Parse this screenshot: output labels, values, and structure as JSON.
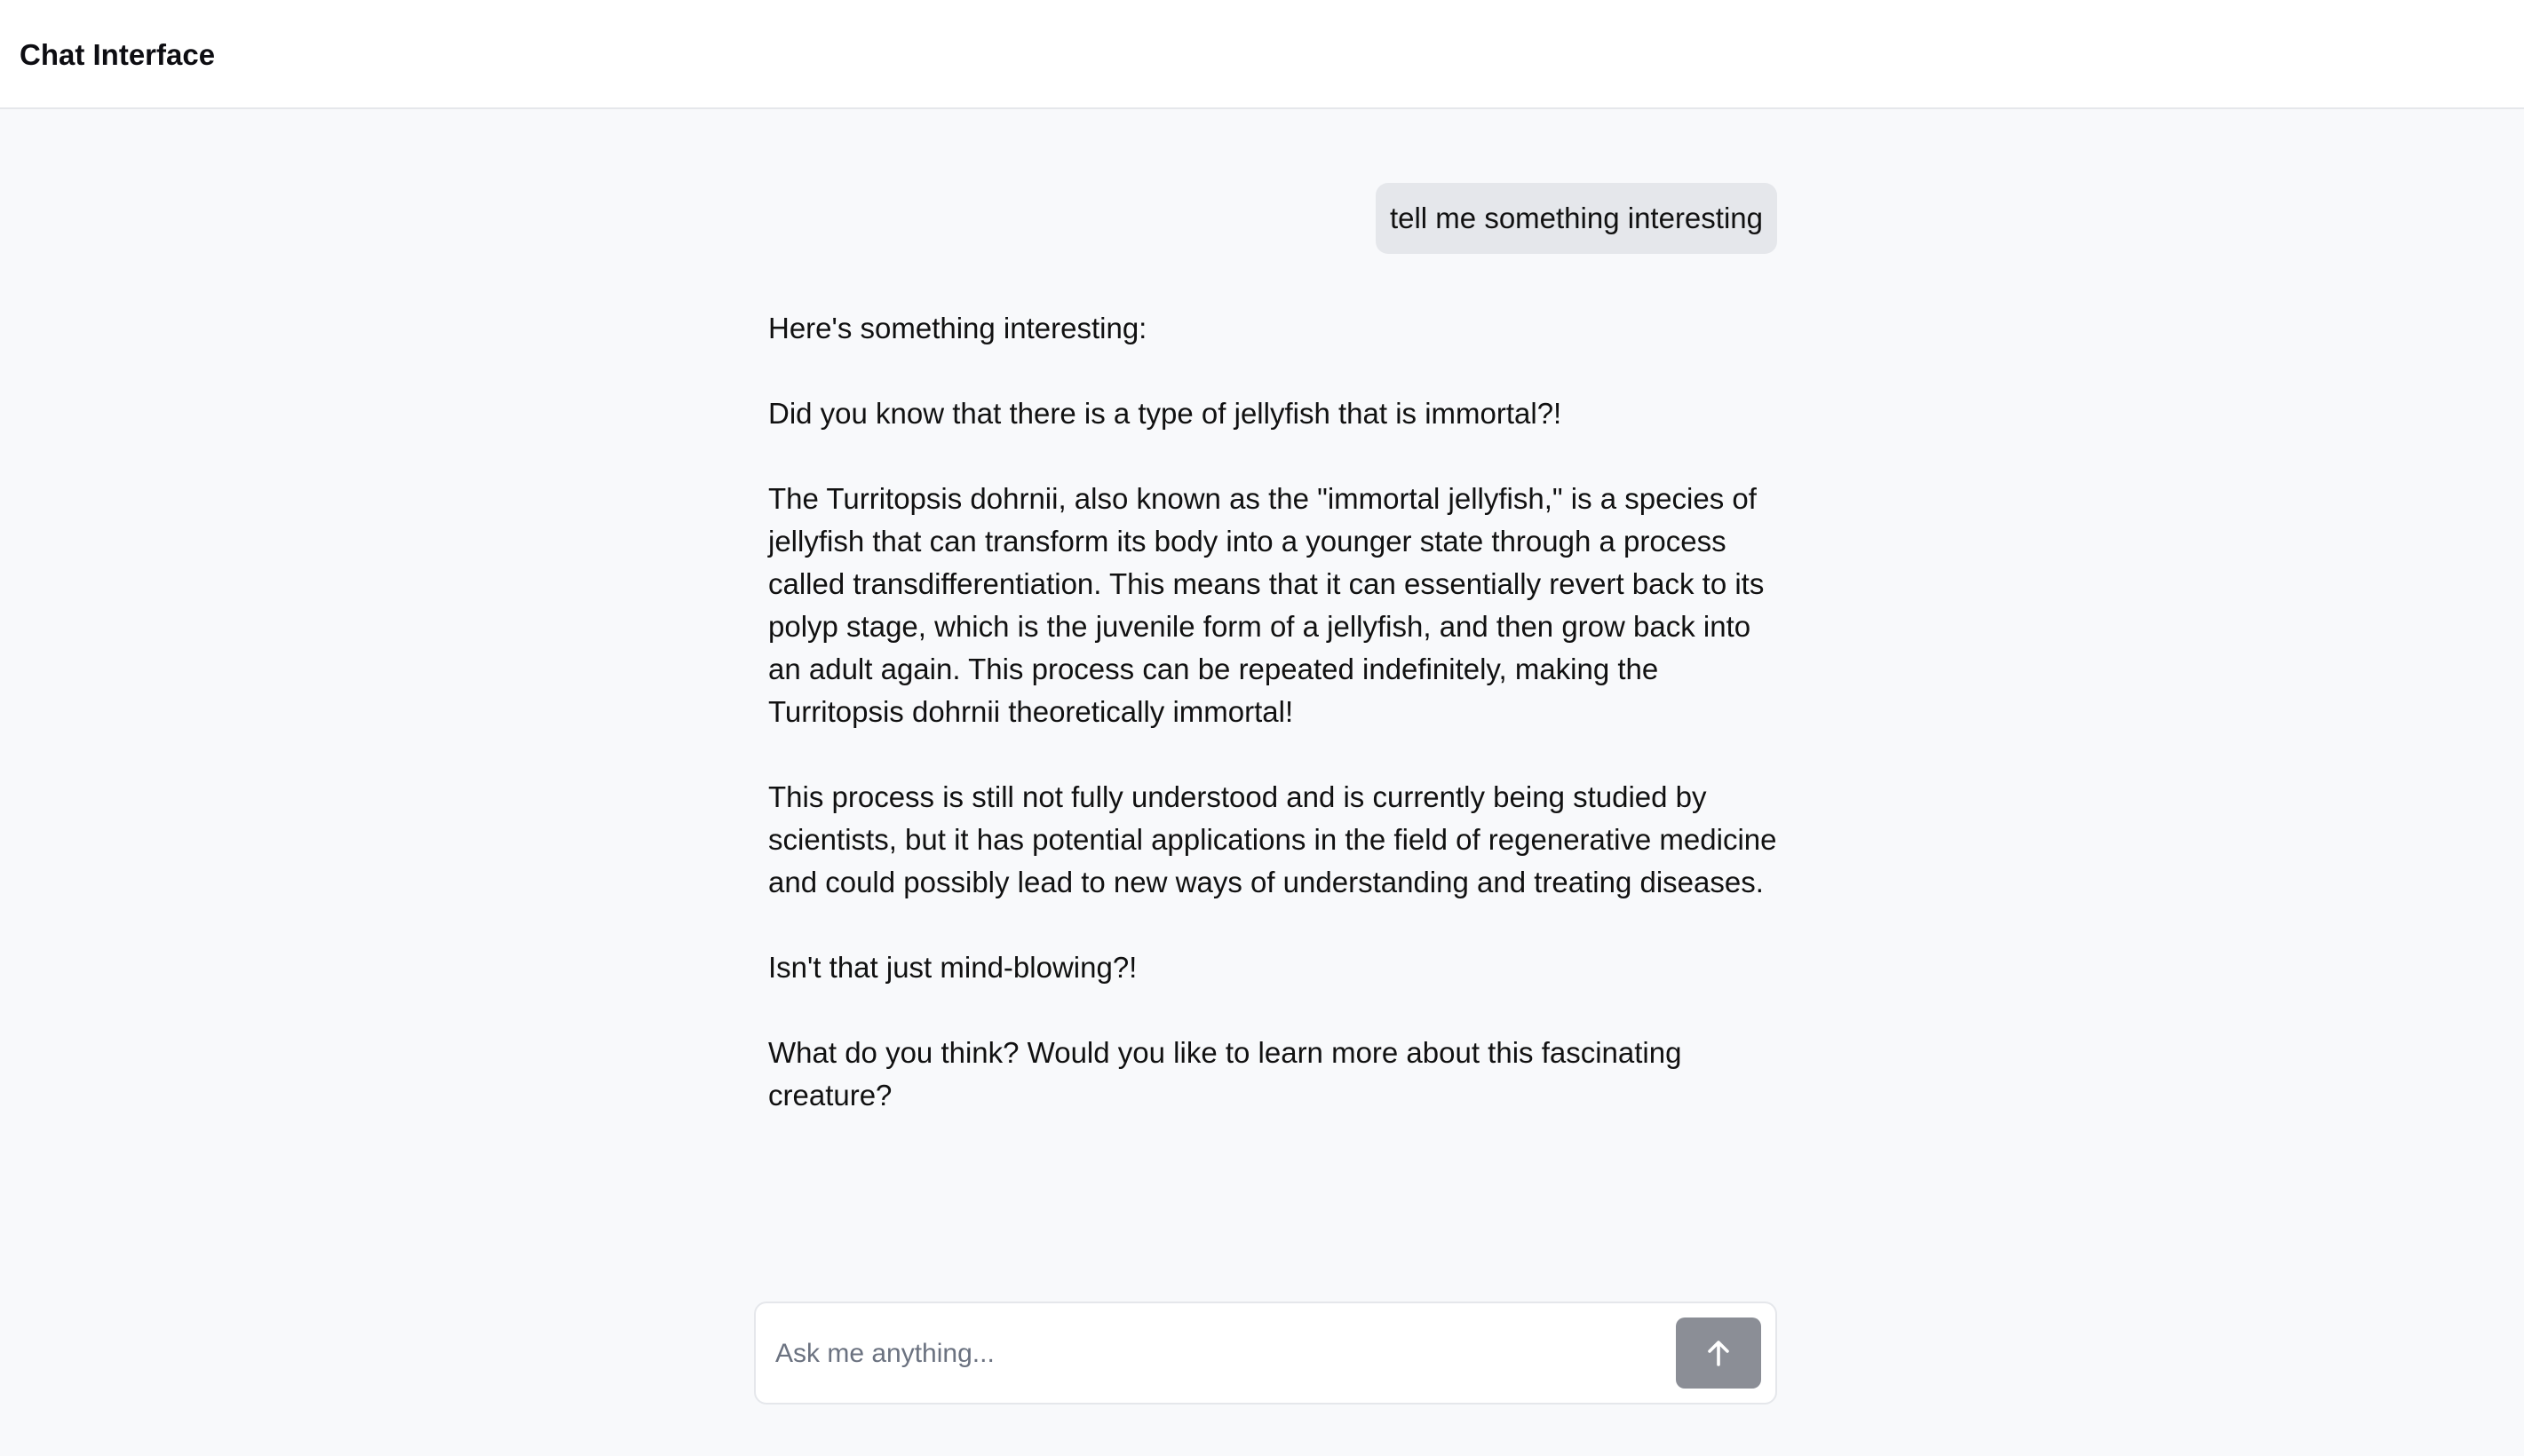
{
  "app": {
    "title": "Chat Interface"
  },
  "conversation": {
    "user_message": "tell me something interesting",
    "assistant_paragraphs": [
      "Here's something interesting:",
      "Did you know that there is a type of jellyfish that is immortal?!",
      "The Turritopsis dohrnii, also known as the \"immortal jellyfish,\" is a species of jellyfish that can transform its body into a younger state through a process called transdifferentiation. This means that it can essentially revert back to its polyp stage, which is the juvenile form of a jellyfish, and then grow back into an adult again. This process can be repeated indefinitely, making the Turritopsis dohrnii theoretically immortal!",
      "This process is still not fully understood and is currently being studied by scientists, but it has potential applications in the field of regenerative medicine and could possibly lead to new ways of understanding and treating diseases.",
      "Isn't that just mind-blowing?!",
      "What do you think? Would you like to learn more about this fascinating creature?"
    ]
  },
  "composer": {
    "value": "",
    "placeholder": "Ask me anything...",
    "send_icon": "arrow-up-icon"
  },
  "colors": {
    "page_background": "#f8f9fb",
    "header_background": "#ffffff",
    "user_bubble": "#e5e7eb",
    "send_button": "#8b8e96"
  }
}
